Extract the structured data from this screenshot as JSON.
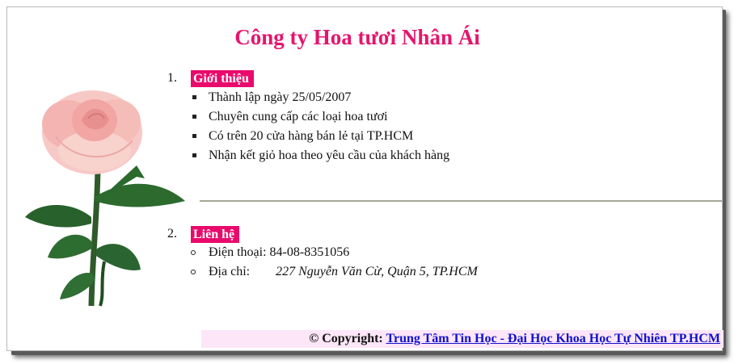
{
  "header": {
    "title": "Công ty Hoa tươi Nhân Ái"
  },
  "section1": {
    "number": "1.",
    "heading": "Giới thiệu",
    "items": [
      "Thành lập ngày 25/05/2007",
      "Chuyên cung cấp các loại hoa tươi",
      "Có trên 20 cửa hàng bán lẻ tại TP.HCM",
      "Nhận kết giỏ hoa theo yêu cầu của khách hàng"
    ]
  },
  "section2": {
    "number": "2.",
    "heading": "Liên hệ",
    "phone_label": "Điện thoại:",
    "phone_value": "84-08-8351056",
    "address_label": "Địa chỉ:",
    "address_value": "227 Nguyễn Văn Cừ, Quận 5, TP.HCM"
  },
  "footer": {
    "copyright_label": "© Copyright:",
    "link_text": "Trung Tâm Tin Học - Đại Học Khoa Học Tự Nhiên TP.HCM"
  },
  "colors": {
    "title": "#e5156d",
    "badge_bg": "#e90a6c",
    "footer_bg": "#fce6f7",
    "link": "#1111cc"
  },
  "icons": [
    "rose-image",
    "square-bullet-icon",
    "circle-bullet-icon"
  ]
}
